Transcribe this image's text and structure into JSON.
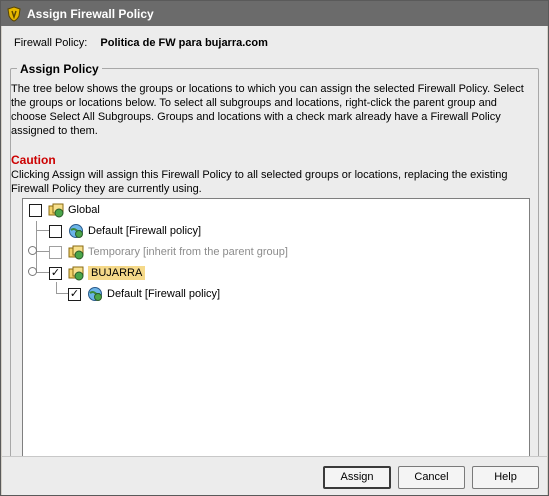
{
  "window": {
    "title": "Assign Firewall Policy",
    "icon": "shield-icon"
  },
  "firewall": {
    "label": "Firewall Policy:",
    "value": "Politica de FW para bujarra.com"
  },
  "assign_policy": {
    "title": "Assign Policy",
    "description": "The tree below shows the groups or locations to which you can assign the selected Firewall Policy. Select the groups or locations below. To select all subgroups and locations, right-click the parent group and choose Select All Subgroups. Groups and locations with a check mark already have a Firewall Policy assigned to them.",
    "caution_title": "Caution",
    "caution_text": "Clicking Assign will assign this Firewall Policy to all selected groups or locations, replacing the existing Firewall Policy they are currently using."
  },
  "tree": {
    "items": [
      {
        "label": "Global",
        "checked": false,
        "icon": "group-icon"
      },
      {
        "label": "Default [Firewall policy]",
        "checked": false,
        "icon": "location-icon"
      },
      {
        "label": "Temporary [inherit from the parent group]",
        "checked": false,
        "icon": "group-icon",
        "disabled": true
      },
      {
        "label": "BUJARRA",
        "checked": true,
        "icon": "group-icon",
        "selected": true
      },
      {
        "label": "Default [Firewall policy]",
        "checked": true,
        "icon": "location-icon"
      }
    ]
  },
  "buttons": {
    "assign": "Assign",
    "cancel": "Cancel",
    "help": "Help"
  },
  "colors": {
    "title_bar": "#6b6b6b",
    "caution": "#cc0000",
    "selection": "#f5d98a"
  }
}
